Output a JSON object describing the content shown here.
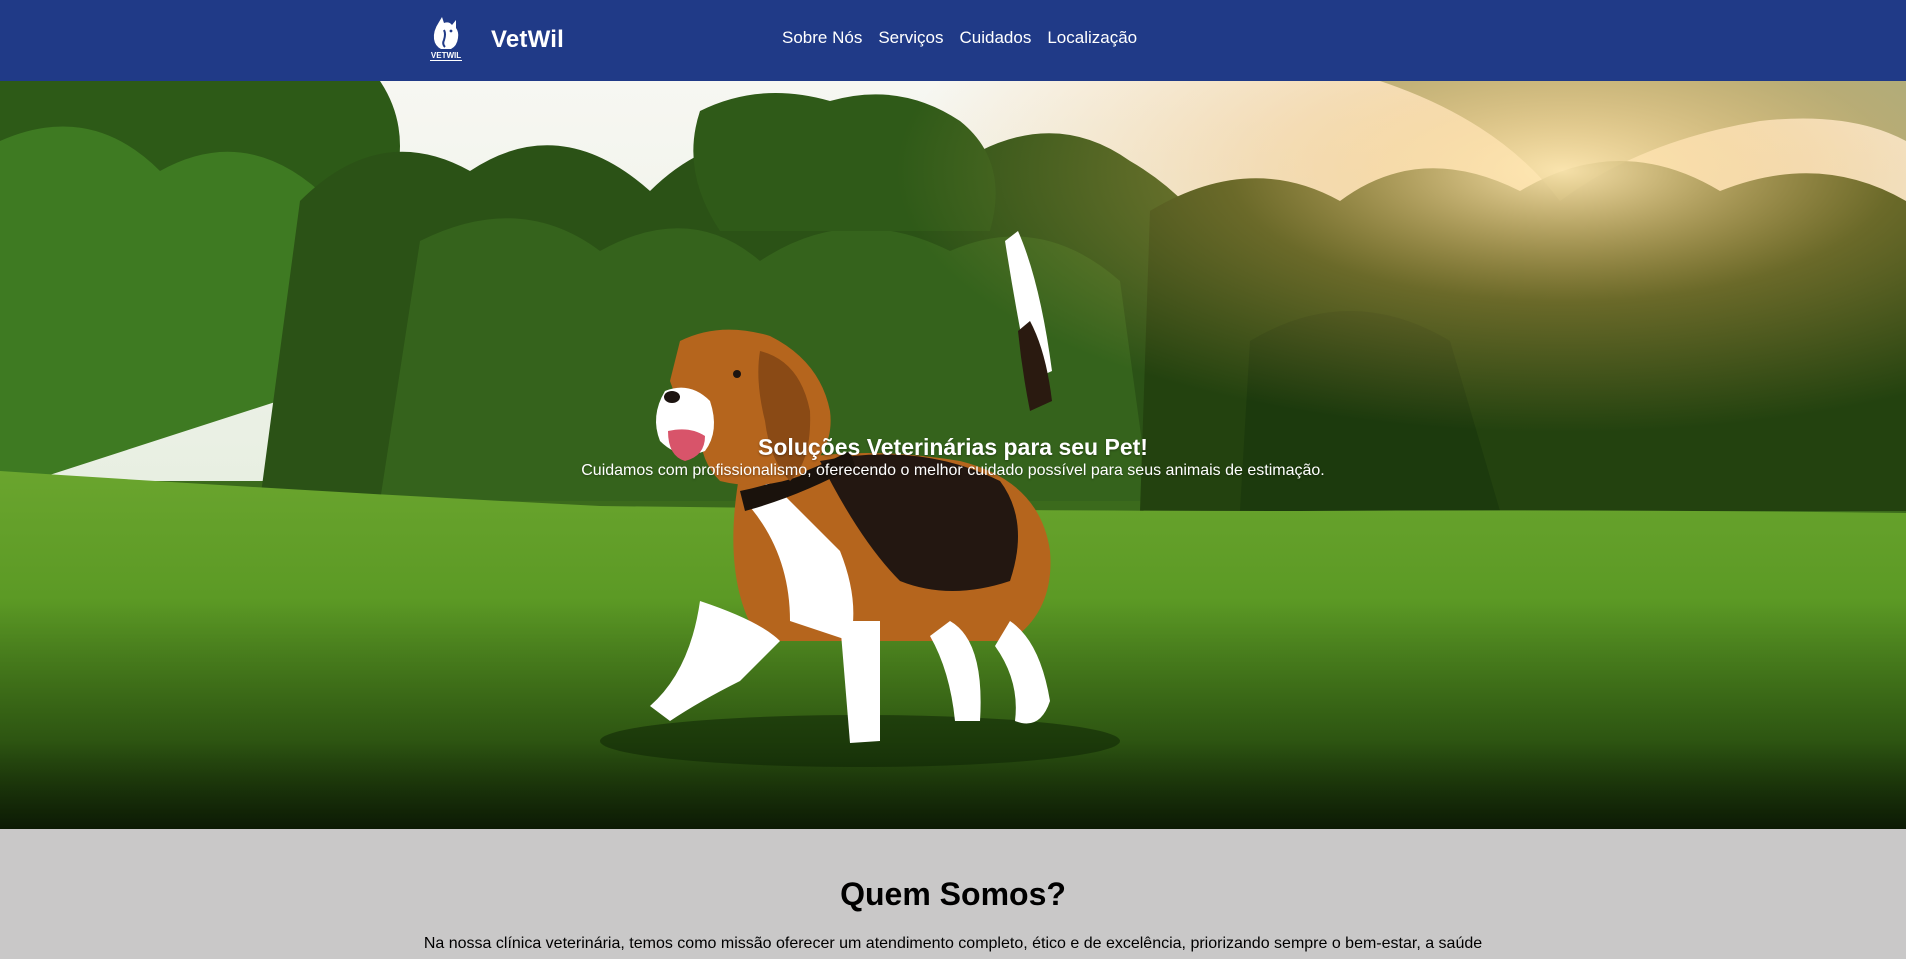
{
  "header": {
    "brand_name": "VetWil",
    "logo_text": "VETWIL",
    "nav": [
      {
        "label": "Sobre Nós"
      },
      {
        "label": "Serviços"
      },
      {
        "label": "Cuidados"
      },
      {
        "label": "Localização"
      }
    ],
    "background_color": "#203a87"
  },
  "hero": {
    "title": "Soluções Veterinárias para seu Pet!",
    "subtitle": "Cuidamos com profissionalismo, oferecendo o melhor cuidado possível para seus animais de estimação."
  },
  "about": {
    "title": "Quem Somos?",
    "text": "Na nossa clínica veterinária, temos como missão oferecer um atendimento completo, ético e de excelência, priorizando sempre o bem-estar, a saúde"
  }
}
